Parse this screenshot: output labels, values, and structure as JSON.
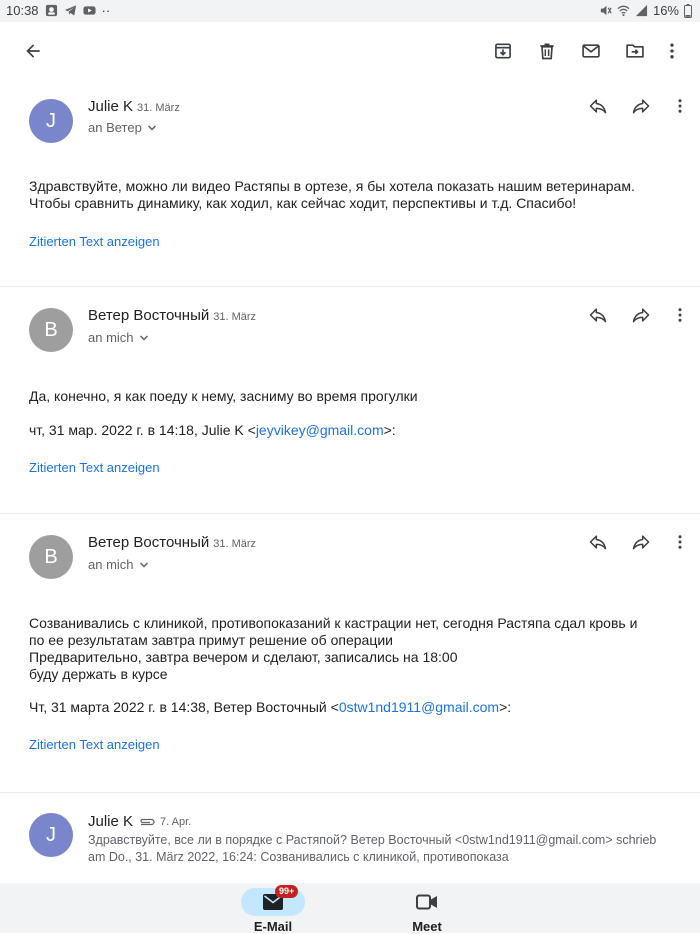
{
  "status_bar": {
    "time": "10:38",
    "battery": "16%",
    "dots": "··"
  },
  "toolbar": {
    "back_icon": "arrow-left-icon",
    "actions": [
      "archive-icon",
      "delete-icon",
      "mark-unread-icon",
      "move-to-icon",
      "more-vert-icon"
    ]
  },
  "messages": [
    {
      "sender": "Julie K",
      "date": "31. März",
      "recipient": "an Ветер",
      "avatar_letter": "J",
      "avatar_color": "#7986cb",
      "body_lines": [
        "Здравствуйте,  можно ли видео Растяпы в ортезе, я бы хотела показать нашим ветеринарам.",
        "Чтобы сравнить динамику,  как ходил, как сейчас ходит, перспективы и т.д. Спасибо!"
      ],
      "quote_link": "Zitierten Text anzeigen"
    },
    {
      "sender": "Ветер Восточный",
      "date": "31. März",
      "recipient": "an mich",
      "avatar_letter": "В",
      "avatar_color": "#9e9e9e",
      "body_lines": [
        "Да, конечно, я как поеду к нему, засниму во время прогулки"
      ],
      "quoted_prefix": "чт, 31 мар. 2022 г. в 14:18, Julie K <",
      "quoted_email": "jeyvikey@gmail.com",
      "quoted_suffix": ">:",
      "quote_link": "Zitierten Text anzeigen"
    },
    {
      "sender": "Ветер Восточный",
      "date": "31. März",
      "recipient": "an mich",
      "avatar_letter": "В",
      "avatar_color": "#9e9e9e",
      "body_lines": [
        "Созванивались с клиникой, противопоказаний к кастрации нет, сегодня Растяпа сдал кровь и",
        "по ее результатам завтра примут решение об операции",
        "Предварительно, завтра вечером и сделают, записались на 18:00",
        "буду держать в курсе"
      ],
      "quoted_prefix": "Чт, 31 марта 2022 г. в 14:38, Ветер Восточный <",
      "quoted_email": "0stw1nd1911@gmail.com",
      "quoted_suffix": ">:",
      "quote_link": "Zitierten Text anzeigen"
    },
    {
      "sender": "Julie K",
      "date": "7. Apr.",
      "avatar_letter": "J",
      "avatar_color": "#7986cb",
      "preview_lines": [
        "Здравствуйте, все ли в порядке с Растяпой? Ветер Восточный <0stw1nd1911@gmail.com> schrieb",
        "am Do., 31. März 2022, 16:24: Созванивались с клиникой, противопоказа"
      ]
    }
  ],
  "bottom_nav": {
    "mail_label": "E-Mail",
    "mail_badge": "99+",
    "meet_label": "Meet"
  }
}
